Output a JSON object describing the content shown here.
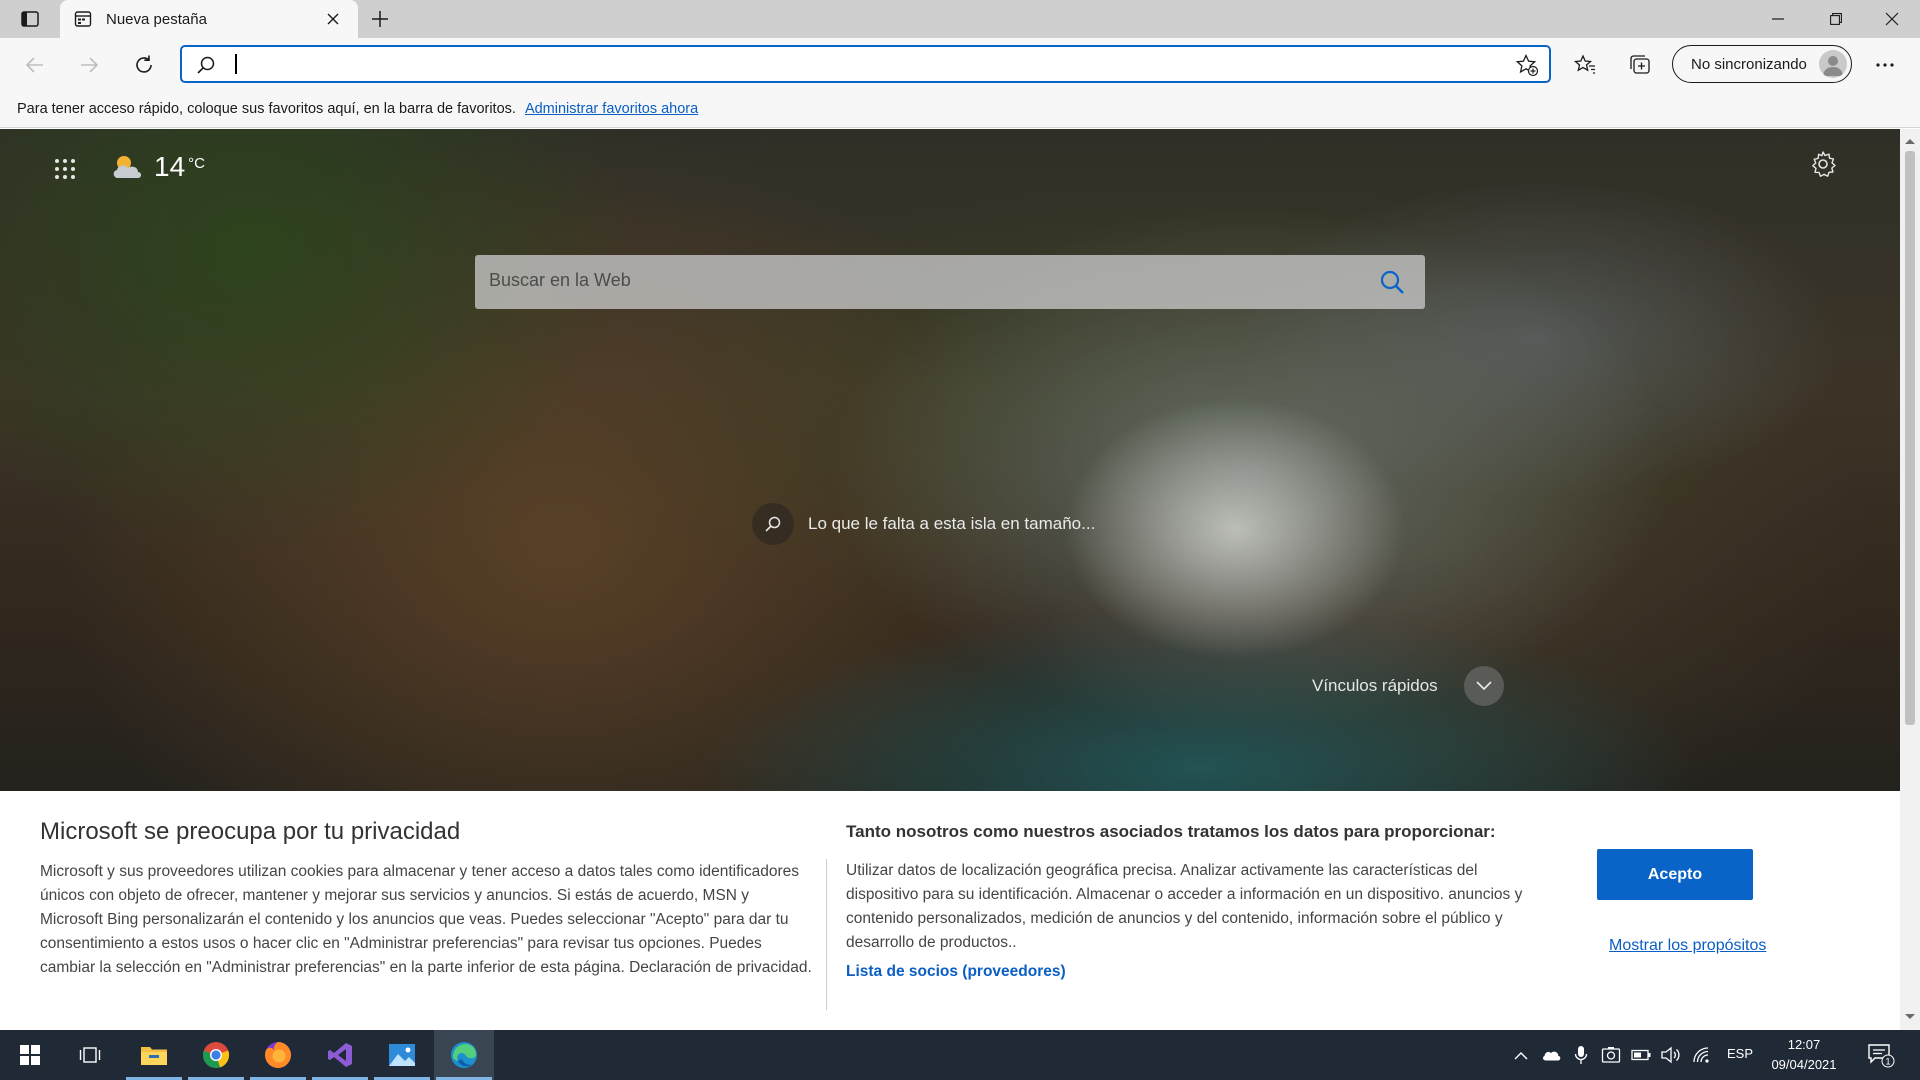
{
  "browser": {
    "tab_title": "Nueva pestaña",
    "address_value": "",
    "profile_label": "No sincronizando"
  },
  "favorites_bar": {
    "text": "Para tener acceso rápido, coloque sus favoritos aquí, en la barra de favoritos.",
    "link": "Administrar favoritos ahora"
  },
  "newtab": {
    "temperature": "14",
    "temp_unit": "°C",
    "search_placeholder": "Buscar en la Web",
    "image_caption": "Lo que le falta a esta isla en tamaño...",
    "quick_links": "Vínculos rápidos"
  },
  "consent": {
    "title": "Microsoft se preocupa por tu privacidad",
    "body": "Microsoft y sus proveedores utilizan cookies para almacenar y tener acceso a datos tales como identificadores únicos con objeto de ofrecer, mantener y mejorar sus servicios y anuncios. Si estás de acuerdo, MSN y Microsoft Bing personalizarán el contenido y los anuncios que veas. Puedes seleccionar \"Acepto\" para dar tu consentimiento a estos usos o hacer clic en \"Administrar preferencias\" para revisar tus opciones. Puedes cambiar la selección en \"Administrar preferencias\" en la parte inferior de esta página. Declaración de privacidad.",
    "title2": "Tanto nosotros como nuestros asociados tratamos los datos para proporcionar:",
    "body2": "Utilizar datos de localización geográfica precisa. Analizar activamente las características del dispositivo para su identificación. Almacenar o acceder a información en un dispositivo. anuncios y contenido personalizados, medición de anuncios y del contenido, información sobre el público y desarrollo de productos..",
    "partners_link": "Lista de socios (proveedores)",
    "accept_label": "Acepto",
    "purposes_link": "Mostrar los propósitos"
  },
  "taskbar": {
    "apps": [
      "windows-start",
      "task-view",
      "file-explorer",
      "chrome",
      "firefox",
      "visual-studio",
      "photos",
      "edge"
    ],
    "active_app": "edge",
    "language": "ESP",
    "time": "12:07",
    "date": "09/04/2021",
    "notification_count": "1"
  },
  "colors": {
    "accent": "#0a64c8",
    "link": "#0a5ec4",
    "taskbar": "#1f2a36",
    "titlebar": "#cfcfcf"
  }
}
